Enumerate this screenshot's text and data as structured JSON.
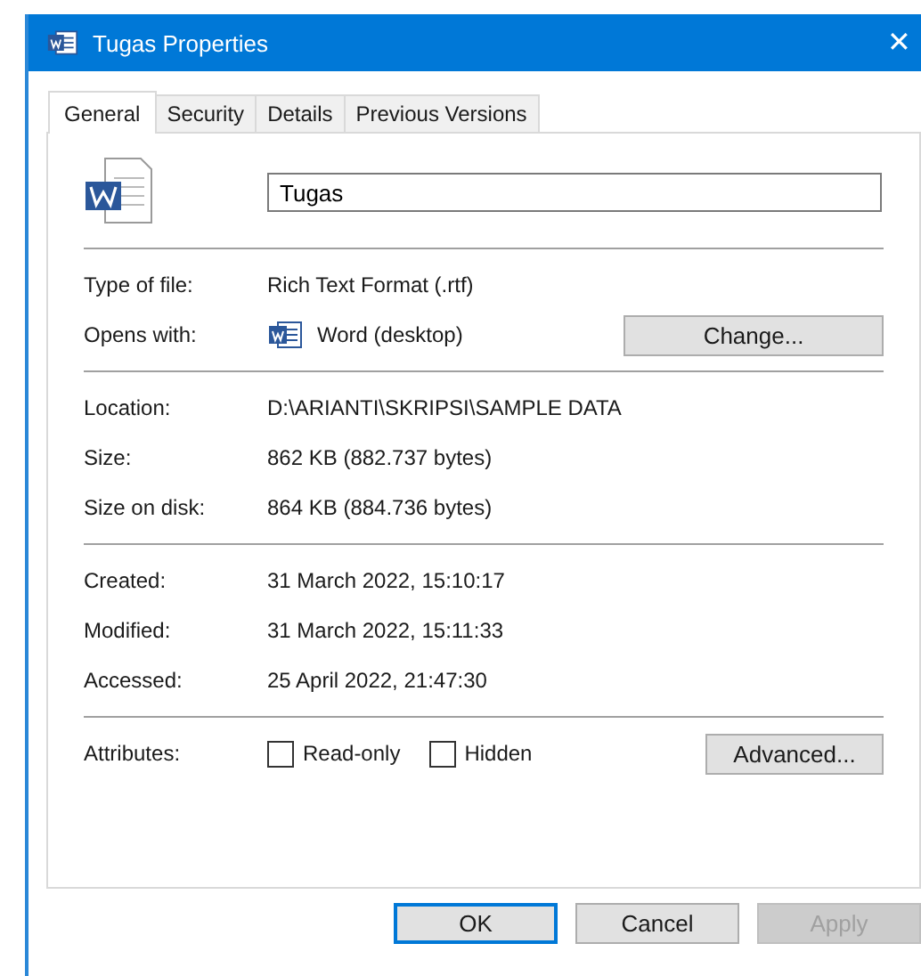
{
  "window": {
    "title": "Tugas Properties",
    "close": "✕"
  },
  "tabs": [
    {
      "label": "General",
      "selected": true
    },
    {
      "label": "Security",
      "selected": false
    },
    {
      "label": "Details",
      "selected": false
    },
    {
      "label": "Previous Versions",
      "selected": false
    }
  ],
  "name_field": {
    "value": "Tugas"
  },
  "sections": [
    [
      {
        "kind": "text",
        "label": "Type of file:",
        "value": "Rich Text Format (.rtf)"
      },
      {
        "kind": "app",
        "label": "Opens with:",
        "value": "Word (desktop)",
        "button": "Change..."
      }
    ],
    [
      {
        "kind": "text",
        "label": "Location:",
        "value": "D:\\ARIANTI\\SKRIPSI\\SAMPLE DATA"
      },
      {
        "kind": "text",
        "label": "Size:",
        "value": "862 KB (882.737 bytes)"
      },
      {
        "kind": "text",
        "label": "Size on disk:",
        "value": "864 KB (884.736 bytes)"
      }
    ],
    [
      {
        "kind": "text",
        "label": "Created:",
        "value": "31 March 2022, 15:10:17"
      },
      {
        "kind": "text",
        "label": "Modified:",
        "value": "31 March 2022, 15:11:33"
      },
      {
        "kind": "text",
        "label": "Accessed:",
        "value": "25 April 2022, 21:47:30"
      }
    ]
  ],
  "attributes": {
    "label": "Attributes:",
    "checkboxes": [
      {
        "label": "Read-only",
        "checked": false
      },
      {
        "label": "Hidden",
        "checked": false
      }
    ],
    "button": "Advanced..."
  },
  "buttons": [
    {
      "label": "OK",
      "default": true,
      "disabled": false
    },
    {
      "label": "Cancel",
      "default": false,
      "disabled": false
    },
    {
      "label": "Apply",
      "default": false,
      "disabled": true
    }
  ]
}
